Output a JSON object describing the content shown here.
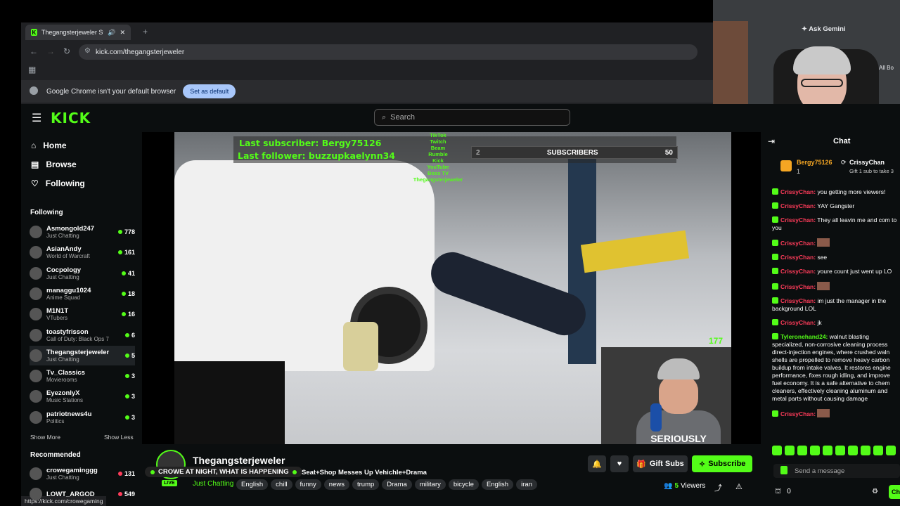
{
  "browser": {
    "tab_title": "Thegangsterjeweler Stream",
    "url": "kick.com/thegangsterjeweler",
    "default_notice": "Google Chrome isn't your default browser",
    "set_default": "Set as default",
    "ask_gemini": "Ask Gemini",
    "all_bookmarks": "All Bo",
    "status_url": "https://kick.com/crowegaming"
  },
  "header": {
    "logo": "KICK",
    "search_placeholder": "Search"
  },
  "sidebar": {
    "nav": [
      {
        "label": "Home",
        "icon": "home-icon"
      },
      {
        "label": "Browse",
        "icon": "browse-icon"
      },
      {
        "label": "Following",
        "icon": "heart-icon"
      }
    ],
    "following_title": "Following",
    "following": [
      {
        "name": "Asmongold247",
        "category": "Just Chatting",
        "viewers": "778"
      },
      {
        "name": "AsianAndy",
        "category": "World of Warcraft",
        "viewers": "161"
      },
      {
        "name": "Cocpology",
        "category": "Just Chatting",
        "viewers": "41"
      },
      {
        "name": "managgu1024",
        "category": "Anime Squad",
        "viewers": "18"
      },
      {
        "name": "M1N1T",
        "category": "VTubers",
        "viewers": "16"
      },
      {
        "name": "toastyfrisson",
        "category": "Call of Duty: Black Ops 7",
        "viewers": "6"
      },
      {
        "name": "Thegangsterjeweler",
        "category": "Just Chatting",
        "viewers": "5"
      },
      {
        "name": "Tv_Classics",
        "category": "Movierooms",
        "viewers": "3"
      },
      {
        "name": "EyezonlyX",
        "category": "Music Stations",
        "viewers": "3"
      },
      {
        "name": "patriotnews4u",
        "category": "Politics",
        "viewers": "3"
      }
    ],
    "show_more": "Show More",
    "show_less": "Show Less",
    "recommended_title": "Recommended",
    "recommended": [
      {
        "name": "crowegaminggg",
        "category": "Just Chatting",
        "viewers": "131"
      },
      {
        "name": "LOWT_ARGOD",
        "category": "",
        "viewers": "549"
      }
    ]
  },
  "video": {
    "last_subscriber": "Last subscriber: Bergy75126",
    "last_follower": "Last follower: buzzupkaelynn34",
    "platforms": [
      "TikTok",
      "Twitch",
      "Beam",
      "Rumble",
      "Kick",
      "YouTube",
      "Boss TV",
      "Thegangsterjeweler"
    ],
    "sub_goal_current": "2",
    "sub_goal_label": "SUBSCRIBERS",
    "sub_goal_target": "50",
    "viewer_overlay": "177",
    "shirt_text": "SERIOUSLY"
  },
  "stream_info": {
    "channel": "Thegangsterjeweler",
    "live": "LIVE",
    "ticker": "CROWE AT NIGHT, WHAT IS HAPPENING",
    "title": "Seat+Shop Messes Up Vehichle+Drama",
    "category": "Just Chatting",
    "tags": [
      "English",
      "chill",
      "funny",
      "news",
      "trump",
      "Drama",
      "military",
      "bicycle",
      "English",
      "iran"
    ],
    "gift_subs": "Gift Subs",
    "subscribe": "Subscribe",
    "viewers_count": "5",
    "viewers_label": "Viewers"
  },
  "chat": {
    "title": "Chat",
    "pinned_user1": "Bergy75126",
    "pinned_user2": "CrissyChan",
    "pinned_num": "1",
    "pinned_gift": "Gift 1 sub to take 3",
    "messages": [
      {
        "user": "CrissyChan:",
        "text": "you getting more viewers!"
      },
      {
        "user": "CrissyChan:",
        "text": "YAY Gangster"
      },
      {
        "user": "CrissyChan:",
        "text": "They all leavin me and com to you"
      },
      {
        "user": "CrissyChan:",
        "text": ""
      },
      {
        "user": "CrissyChan:",
        "text": "see"
      },
      {
        "user": "CrissyChan:",
        "text": "youre count just went up LO"
      },
      {
        "user": "CrissyChan:",
        "text": ""
      },
      {
        "user": "CrissyChan:",
        "text": "im just the manager in the background LOL"
      },
      {
        "user": "CrissyChan:",
        "text": "jk"
      },
      {
        "user": "Tyleronehand24:",
        "text": "walnut blasting specialized, non-corrosive cleaning process direct-injection engines, where crushed waln shells are propelled to remove heavy carbon buildup from intake valves. It restores engine performance, fixes rough idling, and improve fuel economy. It is a safe alternative to chem cleaners, effectively cleaning aluminum and metal parts without causing damage"
      },
      {
        "user": "CrissyChan:",
        "text": ""
      }
    ],
    "send_placeholder": "Send a message",
    "points": "0",
    "chat_btn": "Ch"
  },
  "colors": {
    "kick_green": "#53fc18",
    "chat_name": "#ff3c5a",
    "bg": "#0b0e0f"
  }
}
